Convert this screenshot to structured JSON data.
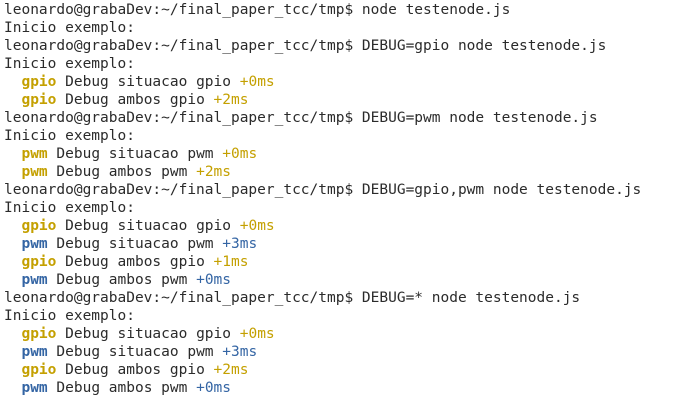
{
  "colors": {
    "text": "#2b2b2b",
    "background": "#ffffff",
    "gpio": "#c4a000",
    "pwm": "#3465a4",
    "delta_gpio": "#c4a000",
    "delta_pwm": "#3465a4"
  },
  "lines": [
    {
      "type": "prompt",
      "text": "leonardo@grabaDev:~/final_paper_tcc/tmp$ node testenode.js"
    },
    {
      "type": "output",
      "text": "Inicio exemplo:"
    },
    {
      "type": "prompt",
      "text": "leonardo@grabaDev:~/final_paper_tcc/tmp$ DEBUG=gpio node testenode.js"
    },
    {
      "type": "output",
      "text": "Inicio exemplo:"
    },
    {
      "type": "debug",
      "ns": "gpio",
      "msg": "Debug situacao gpio",
      "delta": "+0ms"
    },
    {
      "type": "debug",
      "ns": "gpio",
      "msg": "Debug ambos gpio",
      "delta": "+2ms"
    },
    {
      "type": "prompt",
      "text": "leonardo@grabaDev:~/final_paper_tcc/tmp$ DEBUG=pwm node testenode.js"
    },
    {
      "type": "output",
      "text": "Inicio exemplo:"
    },
    {
      "type": "debug",
      "ns": "pwm",
      "msg": "Debug situacao pwm",
      "delta": "+0ms",
      "alt_color": "gpio"
    },
    {
      "type": "debug",
      "ns": "pwm",
      "msg": "Debug ambos pwm",
      "delta": "+2ms",
      "alt_color": "gpio"
    },
    {
      "type": "prompt",
      "text": "leonardo@grabaDev:~/final_paper_tcc/tmp$ DEBUG=gpio,pwm node testenode.js"
    },
    {
      "type": "output",
      "text": "Inicio exemplo:"
    },
    {
      "type": "debug",
      "ns": "gpio",
      "msg": "Debug situacao gpio",
      "delta": "+0ms"
    },
    {
      "type": "debug",
      "ns": "pwm",
      "msg": "Debug situacao pwm",
      "delta": "+3ms"
    },
    {
      "type": "debug",
      "ns": "gpio",
      "msg": "Debug ambos gpio",
      "delta": "+1ms"
    },
    {
      "type": "debug",
      "ns": "pwm",
      "msg": "Debug ambos pwm",
      "delta": "+0ms"
    },
    {
      "type": "prompt",
      "text": "leonardo@grabaDev:~/final_paper_tcc/tmp$ DEBUG=* node testenode.js"
    },
    {
      "type": "output",
      "text": "Inicio exemplo:"
    },
    {
      "type": "debug",
      "ns": "gpio",
      "msg": "Debug situacao gpio",
      "delta": "+0ms"
    },
    {
      "type": "debug",
      "ns": "pwm",
      "msg": "Debug situacao pwm",
      "delta": "+3ms"
    },
    {
      "type": "debug",
      "ns": "gpio",
      "msg": "Debug ambos gpio",
      "delta": "+2ms"
    },
    {
      "type": "debug",
      "ns": "pwm",
      "msg": "Debug ambos pwm",
      "delta": "+0ms"
    }
  ]
}
